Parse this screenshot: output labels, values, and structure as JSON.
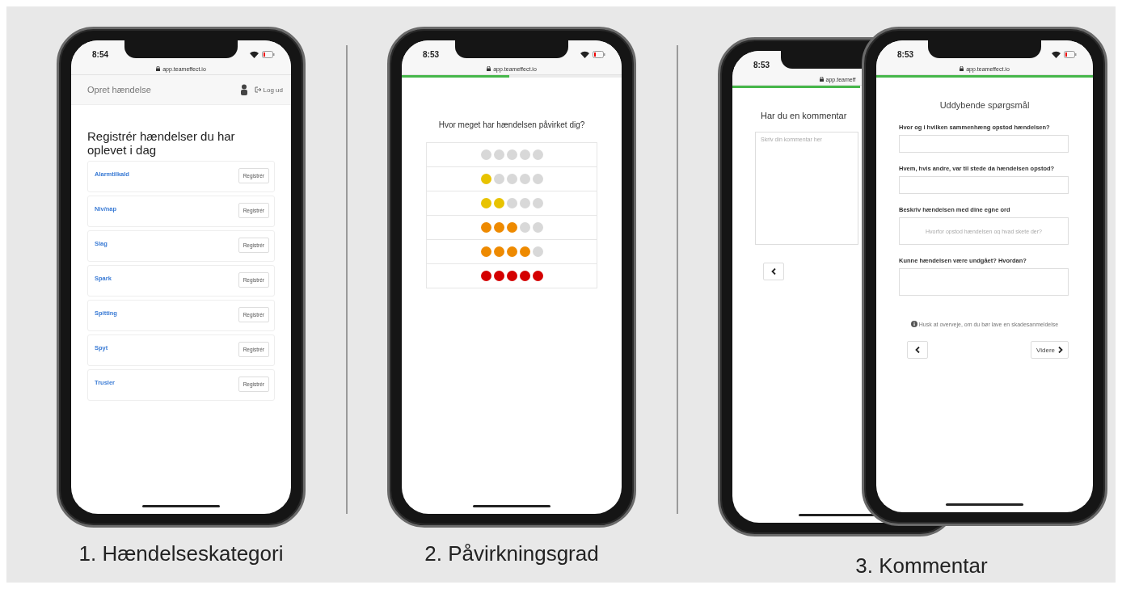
{
  "phone_1": {
    "status": {
      "time": "8:54",
      "url": "app.teameffect.io"
    },
    "header": {
      "title": "Opret hændelse",
      "logout": "Log ud"
    },
    "heading": "Registrér hændelser du har oplevet i dag",
    "categories": [
      {
        "name": "Alarmtilkald",
        "button": "Registrér"
      },
      {
        "name": "Niv/nap",
        "button": "Registrér"
      },
      {
        "name": "Slag",
        "button": "Registrér"
      },
      {
        "name": "Spark",
        "button": "Registrér"
      },
      {
        "name": "Spitting",
        "button": "Registrér"
      },
      {
        "name": "Spyt",
        "button": "Registrér"
      },
      {
        "name": "Trusler",
        "button": "Registrér"
      }
    ],
    "caption": "1. Hændelseskategori"
  },
  "phone_2": {
    "status": {
      "time": "8:53",
      "url": "app.teameffect.io"
    },
    "progress": {
      "level": 0.49
    },
    "question": "Hvor meget har hændelsen påvirket dig?",
    "ratings": [
      {
        "stars": 0
      },
      {
        "stars": 1,
        "color": "#e8c300"
      },
      {
        "stars": 2,
        "color": "#e8c300"
      },
      {
        "stars": 3,
        "color": "#ee8a00"
      },
      {
        "stars": 4,
        "color": "#ee8a00"
      },
      {
        "stars": 5,
        "color": "#d40000"
      }
    ],
    "caption": "2. Påvirkningsgrad"
  },
  "phone_3_back": {
    "status": {
      "time": "8:53",
      "url": "app.teameff"
    },
    "progress": {
      "level": 1
    },
    "question": "Har du en kommentar",
    "comment": {
      "placeholder": "Skriv din kommentar her"
    }
  },
  "phone_3_front": {
    "status": {
      "time": "8:53",
      "url": "app.teameffect.io"
    },
    "progress": {
      "level": 1
    },
    "title": "Uddybende spørgsmål",
    "fields": [
      {
        "label": "Hvor og i hvilken sammenhæng opstod hændelsen?"
      },
      {
        "label": "Hvem, hvis andre, var til stede da hændelsen opstod?"
      },
      {
        "label": "Beskriv hændelsen med dine egne ord",
        "placeholder": "Hvorfor opstod hændelsen og hvad skete der?"
      },
      {
        "label": "Kunne hændelsen være undgået? Hvordan?"
      }
    ],
    "info": "Husk at overveje, om du bør lave en skadesanmeldelse",
    "next_button": "Videre"
  },
  "caption_3": "3. Kommentar"
}
